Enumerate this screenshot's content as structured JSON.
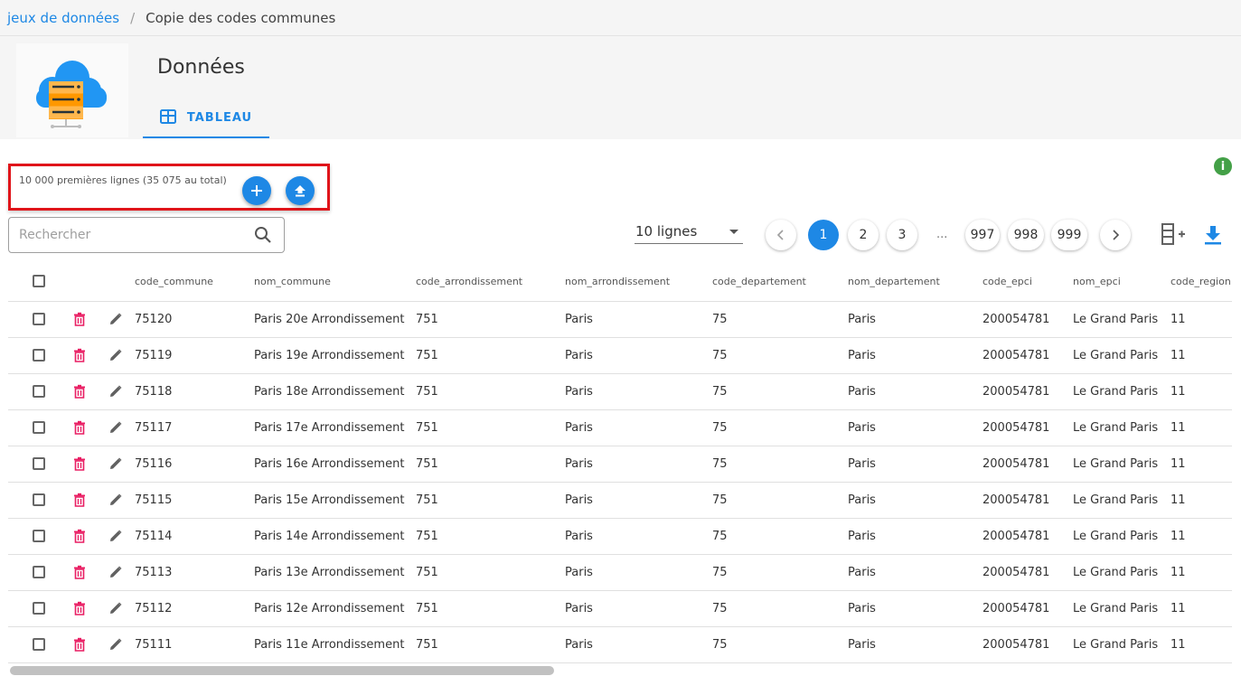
{
  "breadcrumb": {
    "parent": "jeux de données",
    "separator": "/",
    "current": "Copie des codes communes"
  },
  "header": {
    "title": "Données",
    "tab_label": "TABLEAU",
    "tab_icon": "table-icon",
    "logo_icon": "cloud-server-icon"
  },
  "toolbar": {
    "rows_info": "10 000 premières lignes (35 075 au total)",
    "add_icon": "plus-icon",
    "upload_icon": "upload-icon",
    "info_icon": "info-icon",
    "search_placeholder": "Rechercher",
    "search_icon": "search-icon",
    "rows_per_page": "10 lignes",
    "columns_icon": "add-column-icon",
    "download_icon": "download-icon"
  },
  "pagination": {
    "current": "1",
    "pages": [
      "1",
      "2",
      "3",
      "997",
      "998",
      "999"
    ],
    "ellipsis": "..."
  },
  "colors": {
    "accent": "#1e88e5",
    "delete": "#e91e63",
    "info": "#43a047",
    "highlight": "#e0141a"
  },
  "table": {
    "columns": [
      "code_commune",
      "nom_commune",
      "code_arrondissement",
      "nom_arrondissement",
      "code_departement",
      "nom_departement",
      "code_epci",
      "nom_epci",
      "code_region"
    ],
    "rows": [
      [
        "75120",
        "Paris 20e Arrondissement",
        "751",
        "Paris",
        "75",
        "Paris",
        "200054781",
        "Le Grand Paris",
        "11"
      ],
      [
        "75119",
        "Paris 19e Arrondissement",
        "751",
        "Paris",
        "75",
        "Paris",
        "200054781",
        "Le Grand Paris",
        "11"
      ],
      [
        "75118",
        "Paris 18e Arrondissement",
        "751",
        "Paris",
        "75",
        "Paris",
        "200054781",
        "Le Grand Paris",
        "11"
      ],
      [
        "75117",
        "Paris 17e Arrondissement",
        "751",
        "Paris",
        "75",
        "Paris",
        "200054781",
        "Le Grand Paris",
        "11"
      ],
      [
        "75116",
        "Paris 16e Arrondissement",
        "751",
        "Paris",
        "75",
        "Paris",
        "200054781",
        "Le Grand Paris",
        "11"
      ],
      [
        "75115",
        "Paris 15e Arrondissement",
        "751",
        "Paris",
        "75",
        "Paris",
        "200054781",
        "Le Grand Paris",
        "11"
      ],
      [
        "75114",
        "Paris 14e Arrondissement",
        "751",
        "Paris",
        "75",
        "Paris",
        "200054781",
        "Le Grand Paris",
        "11"
      ],
      [
        "75113",
        "Paris 13e Arrondissement",
        "751",
        "Paris",
        "75",
        "Paris",
        "200054781",
        "Le Grand Paris",
        "11"
      ],
      [
        "75112",
        "Paris 12e Arrondissement",
        "751",
        "Paris",
        "75",
        "Paris",
        "200054781",
        "Le Grand Paris",
        "11"
      ],
      [
        "75111",
        "Paris 11e Arrondissement",
        "751",
        "Paris",
        "75",
        "Paris",
        "200054781",
        "Le Grand Paris",
        "11"
      ]
    ]
  }
}
